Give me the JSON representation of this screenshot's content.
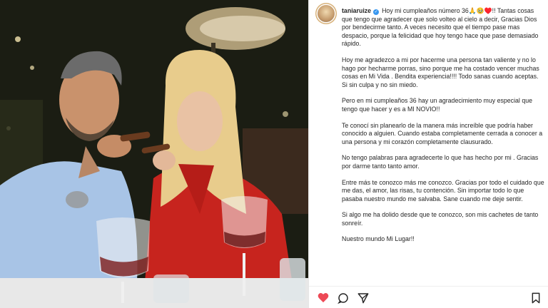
{
  "post": {
    "username": "taniaruize",
    "icons": [
      "verified-badge",
      "heart-icon",
      "comment-icon",
      "share-icon",
      "bookmark-icon"
    ],
    "accent_like": "#ed4956",
    "verified_color": "#3897f0",
    "caption_first": "Hoy mi cumpleaños número 36🙏🥹♥️!! Tantas cosas que tengo que agradecer que solo volteo al cielo a decir, Gracias Dios por bendecirme tanto. A veces necesito que el tiempo pase mas despacio, porque la felicidad que hoy tengo hace que pase demasiado rápido.",
    "paragraphs": [
      "Hoy me agradezco a mi por hacerme una persona tan valiente y no lo hago por hecharme porras, sino porque me ha costado vencer muchas cosas en Mi Vida . Bendita experiencia!!!! Todo sanas cuando aceptas. Si sin culpa y no sin miedo.",
      "Pero en mi cumpleaños 36 hay un agradecimiento muy especial que tengo que hacer y es a MI NOVIO!!",
      "Te conocí sin planearlo de la manera más increíble que podría haber conocido a alguien. Cuando estaba completamente cerrada a conocer a una persona y mi corazón completamente clausurado.",
      "No tengo palabras para agradecerte lo que has hecho por mi . Gracias por darme tanto tanto amor.",
      "Entre más te conozco más me conozco. Gracias por todo el cuidado que me das, el amor, las risas, tu contención. Sin importar todo lo que pasaba nuestro mundo me salvaba. Sane cuando me deje sentir.",
      "Si algo me ha dolido desde que te conozco, son mis cachetes de tanto sonreír.",
      "Nuestro mundo Mi Lugar!!"
    ]
  }
}
